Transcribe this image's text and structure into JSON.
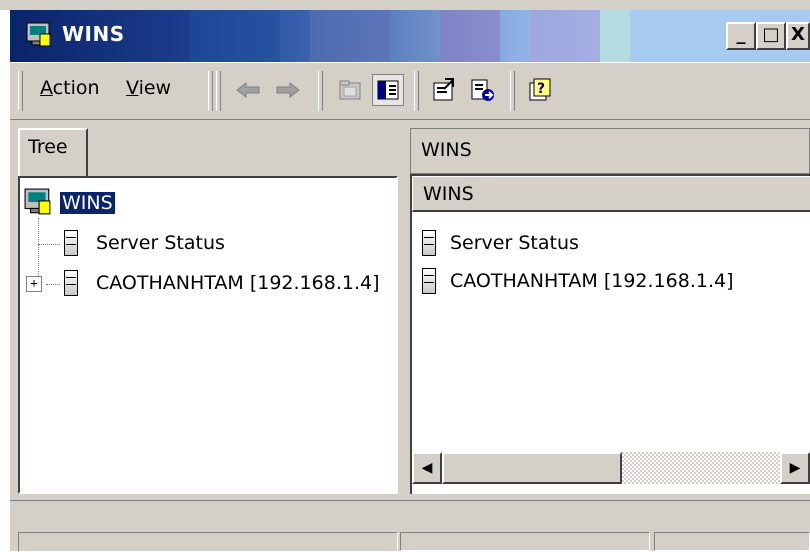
{
  "window": {
    "title": "WINS",
    "caption_buttons": {
      "minimize": "_",
      "maximize": "□",
      "close": "X"
    }
  },
  "menu": {
    "action": {
      "accel": "A",
      "rest": "ction"
    },
    "view": {
      "accel": "V",
      "rest": "iew"
    }
  },
  "toolbar": {
    "icons": [
      "back-arrow-icon",
      "forward-arrow-icon",
      "up-folder-icon",
      "show-hide-tree-icon",
      "properties-icon",
      "export-list-icon",
      "help-icon"
    ]
  },
  "tree": {
    "tab_label": "Tree",
    "root": "WINS",
    "items": [
      {
        "label": "Server Status",
        "expandable": false
      },
      {
        "label": "CAOTHANHTAM [192.168.1.4]",
        "expandable": true,
        "expander": "+"
      }
    ]
  },
  "details": {
    "header": "WINS",
    "column_header": "WINS",
    "items": [
      {
        "label": "Server Status"
      },
      {
        "label": "CAOTHANHTAM [192.168.1.4]"
      }
    ],
    "scroll": {
      "left": "◀",
      "right": "▶"
    }
  },
  "colors": {
    "title_start": "#0a246a",
    "title_end": "#a6caf0",
    "face": "#d4d0c8",
    "selection": "#0a246a"
  }
}
